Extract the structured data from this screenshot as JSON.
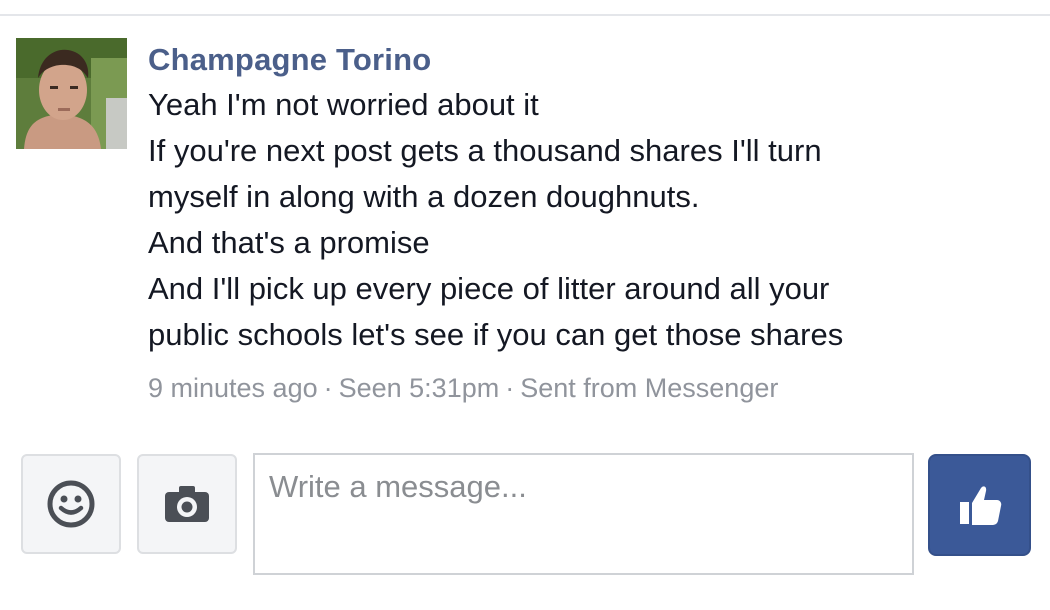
{
  "conversation": {
    "sender_name": "Champagne Torino",
    "message_lines": [
      "Yeah I'm not worried about it",
      "If you're next post gets a thousand shares I'll turn",
      "myself in along with a dozen doughnuts.",
      "And that's a promise",
      "And I'll pick up every piece of litter around all your",
      "public schools let's see if you can get those shares"
    ],
    "meta": {
      "time_ago": "9 minutes ago",
      "seen": "Seen 5:31pm",
      "sent_from": "Sent from Messenger",
      "separator": "·"
    }
  },
  "composer": {
    "placeholder": "Write a message...",
    "emoji_icon": "smiley-face-icon",
    "camera_icon": "camera-icon",
    "send_icon": "thumbs-up-icon"
  },
  "colors": {
    "sender_name": "#4b5f8a",
    "message_text": "#141823",
    "meta_text": "#90949c",
    "like_button": "#3b5998",
    "tool_icon": "#4b4f56"
  }
}
